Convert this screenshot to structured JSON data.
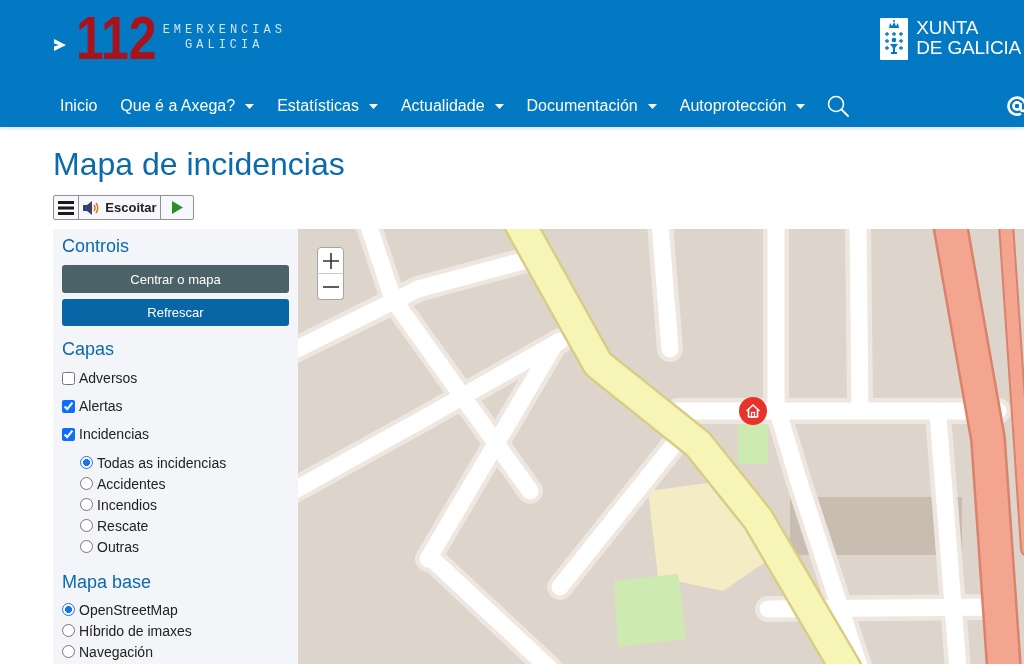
{
  "header": {
    "logo": {
      "number": "112",
      "line_1": "EMERXENCIAS",
      "line_2": "GALICIA"
    },
    "government_logo": {
      "line_1": "XUNTA",
      "line_2": "DE GALICIA"
    }
  },
  "nav": {
    "items": [
      {
        "label": "Inicio",
        "dropdown": false
      },
      {
        "label": "Que é a Axega?",
        "dropdown": true
      },
      {
        "label": "Estatísticas",
        "dropdown": true
      },
      {
        "label": "Actualidade",
        "dropdown": true
      },
      {
        "label": "Documentación",
        "dropdown": true
      },
      {
        "label": "Autoprotección",
        "dropdown": true
      }
    ]
  },
  "page": {
    "title": "Mapa de incidencias"
  },
  "listen_bar": {
    "label": "Escoitar"
  },
  "sidebar": {
    "controls": {
      "heading": "Controis",
      "buttons": [
        {
          "label": "Centrar o mapa",
          "kind": "secondary"
        },
        {
          "label": "Refrescar",
          "kind": "primary"
        }
      ]
    },
    "layers": {
      "heading": "Capas",
      "items": [
        {
          "label": "Adversos",
          "checked": false
        },
        {
          "label": "Alertas",
          "checked": true
        },
        {
          "label": "Incidencias",
          "checked": true,
          "children": [
            {
              "label": "Todas as incidencias",
              "selected": true
            },
            {
              "label": "Accidentes",
              "selected": false
            },
            {
              "label": "Incendios",
              "selected": false
            },
            {
              "label": "Rescate",
              "selected": false
            },
            {
              "label": "Outras",
              "selected": false
            }
          ]
        }
      ]
    },
    "base_map": {
      "heading": "Mapa base",
      "options": [
        {
          "label": "OpenStreetMap",
          "selected": true
        },
        {
          "label": "Híbrido de imaxes",
          "selected": false
        },
        {
          "label": "Navegación",
          "selected": false
        }
      ]
    }
  }
}
